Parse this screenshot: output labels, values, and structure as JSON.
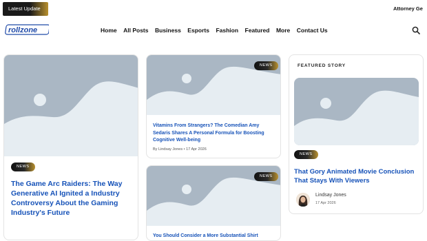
{
  "topbar": {
    "latest_label": "Latest Update",
    "ticker_text": "Attorney Ge"
  },
  "header": {
    "logo_text": "rollzone",
    "nav": [
      "Home",
      "All Posts",
      "Business",
      "Esports",
      "Fashion",
      "Featured",
      "More",
      "Contact Us"
    ]
  },
  "colors": {
    "link_blue": "#1652b8",
    "badge_gold": "#b8902e",
    "placeholder_bg": "#aab7c4",
    "placeholder_hill": "#e6edf2"
  },
  "cards": {
    "left": {
      "badge": "News",
      "title": "The Game Arc Raiders: The Way Generative AI Ignited a Industry Controversy About the Gaming Industry's Future"
    },
    "middle_top": {
      "badge": "News",
      "title": "Vitamins From Strangers? The Comedian Amy Sedaris Shares A Personal Formula for Boosting Cognitive Well-being",
      "author_meta": "By Lindsay Jones",
      "date": "17 Apr 2026"
    },
    "middle_bottom": {
      "badge": "News",
      "title": "You Should Consider a More Substantial Shirt"
    },
    "featured": {
      "label": "Featured Story",
      "badge": "News",
      "title": "That Gory Animated Movie Conclusion That Stays With Viewers",
      "author": "Lindsay Jones",
      "date": "17 Apr 2026"
    }
  }
}
